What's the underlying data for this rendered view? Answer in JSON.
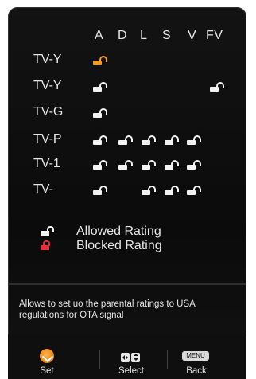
{
  "columns": [
    "A",
    "D",
    "L",
    "S",
    "V",
    "FV"
  ],
  "rows": [
    {
      "label": "TV-Y"
    },
    {
      "label": "TV-Y"
    },
    {
      "label": "TV-G"
    },
    {
      "label": "TV-P"
    },
    {
      "label": "TV-1"
    },
    {
      "label": "TV-"
    }
  ],
  "legend": {
    "allowed": "Allowed Rating",
    "blocked": "Blocked Rating"
  },
  "help_text": "Allows to set uo the parental ratings to USA regulations for OTA signal",
  "keys": {
    "set": "Set",
    "select": "Select",
    "back": "Back",
    "menu_button_text": "MENU"
  },
  "colors": {
    "allowed": "#f2f2f2",
    "blocked": "#e53030",
    "selected": "#f29b1d"
  }
}
